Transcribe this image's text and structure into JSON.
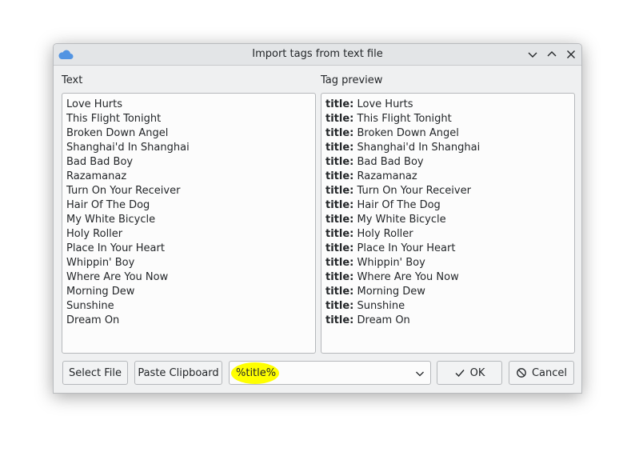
{
  "window": {
    "title": "Import tags from text file",
    "icon": "cloud-icon"
  },
  "titlebar": {
    "buttons": [
      "minimize-icon",
      "maximize-icon",
      "close-icon"
    ]
  },
  "left": {
    "label": "Text",
    "lines": [
      "Love Hurts",
      "This Flight Tonight",
      "Broken Down Angel",
      "Shanghai'd In Shanghai",
      "Bad Bad Boy",
      "Razamanaz",
      "Turn On Your Receiver",
      "Hair Of The Dog",
      "My White Bicycle",
      "Holy Roller",
      "Place In Your Heart",
      "Whippin' Boy",
      "Where Are You Now",
      "Morning Dew",
      "Sunshine",
      "Dream On"
    ]
  },
  "right": {
    "label": "Tag preview",
    "key": "title:",
    "values": [
      "Love Hurts",
      "This Flight Tonight",
      "Broken Down Angel",
      "Shanghai'd In Shanghai",
      "Bad Bad Boy",
      "Razamanaz",
      "Turn On Your Receiver",
      "Hair Of The Dog",
      "My White Bicycle",
      "Holy Roller",
      "Place In Your Heart",
      "Whippin' Boy",
      "Where Are You Now",
      "Morning Dew",
      "Sunshine",
      "Dream On"
    ]
  },
  "footer": {
    "select_file": "Select File",
    "paste_clipboard": "Paste Clipboard",
    "format_value": "%title%",
    "ok": "OK",
    "cancel": "Cancel"
  },
  "colors": {
    "accent": "#3daee9",
    "highlight": "#ffff00"
  }
}
